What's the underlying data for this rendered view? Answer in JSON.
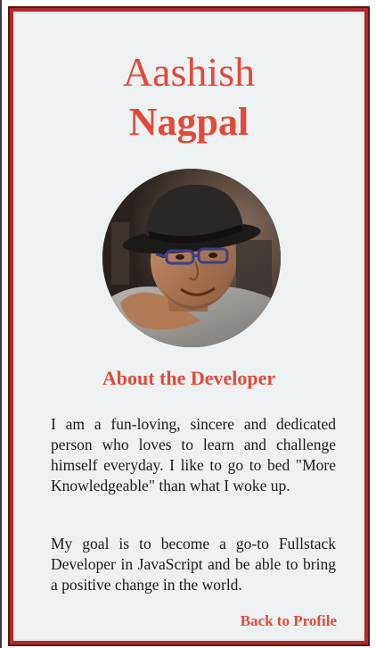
{
  "profile": {
    "first_name": "Aashish",
    "last_name": "Nagpal",
    "avatar_icon": "person-photo"
  },
  "about": {
    "title": "About the Developer",
    "paragraphs": [
      "I am a fun-loving, sincere and dedicated person who loves to learn and challenge himself everyday. I like to go to bed \"More Knowledgeable\" than what I woke up.",
      "My goal is to become a go-to Fullstack Developer in JavaScript and be able to bring a positive change in the world."
    ]
  },
  "nav": {
    "back_label": "Back to Profile"
  },
  "colors": {
    "accent": "#e04a3a",
    "border": "#b02a2a",
    "card_bg": "#eef1f2",
    "text": "#1a1a1a"
  }
}
